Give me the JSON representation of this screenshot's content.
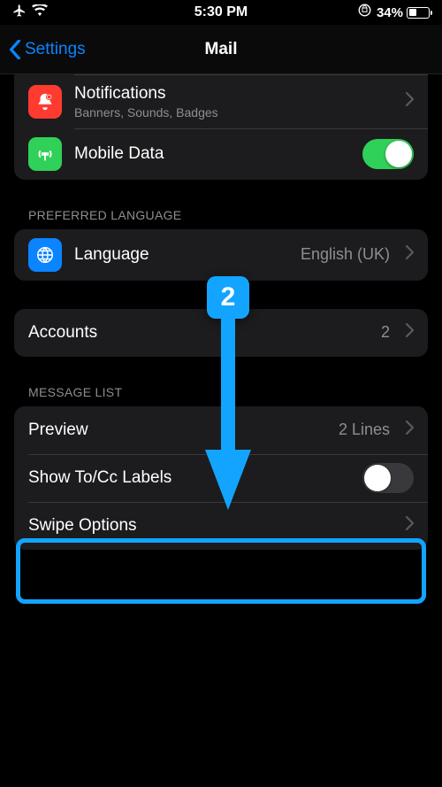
{
  "status": {
    "time": "5:30 PM",
    "battery_pct": "34%"
  },
  "nav": {
    "back": "Settings",
    "title": "Mail"
  },
  "rows": {
    "notifications": {
      "title": "Notifications",
      "sub": "Banners, Sounds, Badges"
    },
    "mobiledata": {
      "title": "Mobile Data"
    },
    "language_header": "PREFERRED LANGUAGE",
    "language": {
      "title": "Language",
      "value": "English (UK)"
    },
    "accounts": {
      "title": "Accounts",
      "value": "2"
    },
    "msglist_header": "MESSAGE LIST",
    "preview": {
      "title": "Preview",
      "value": "2 Lines"
    },
    "tocc": {
      "title": "Show To/Cc Labels"
    },
    "swipe": {
      "title": "Swipe Options"
    }
  },
  "annotation": {
    "badge": "2"
  }
}
